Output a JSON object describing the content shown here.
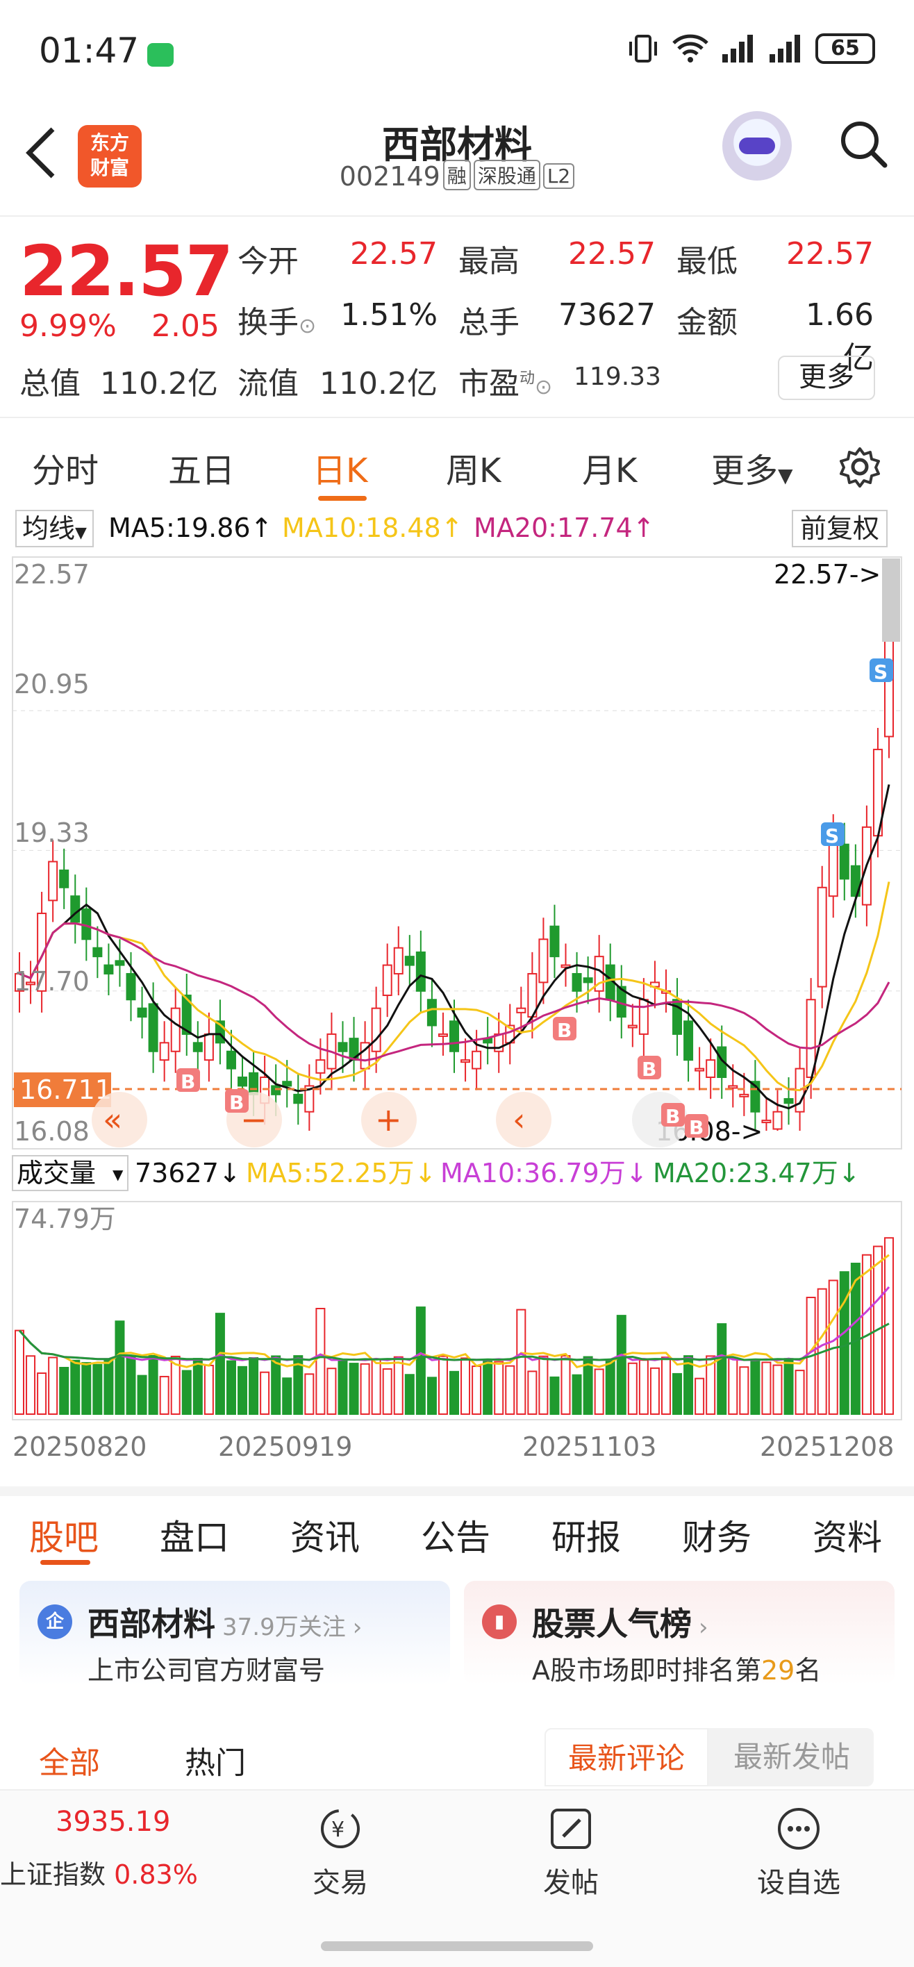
{
  "status": {
    "time": "01:47",
    "battery": "65"
  },
  "header": {
    "title": "西部材料",
    "code": "002149",
    "badges": [
      "融",
      "深股通",
      "L2"
    ],
    "logo_line1": "东方",
    "logo_line2": "财富"
  },
  "quote": {
    "price": "22.57",
    "pct": "9.99%",
    "change": "2.05",
    "open_label": "今开",
    "open": "22.57",
    "high_label": "最高",
    "high": "22.57",
    "low_label": "最低",
    "low": "22.57",
    "turnover_label": "换手",
    "turnover": "1.51%",
    "vol_label": "总手",
    "vol": "73627",
    "amount_label": "金额",
    "amount": "1.66亿",
    "mcap_label": "总值",
    "mcap": "110.2亿",
    "float_label": "流值",
    "float": "110.2亿",
    "pe_label": "市盈",
    "pe_sup": "动",
    "pe": "119.33",
    "more": "更多"
  },
  "period_tabs": [
    "分时",
    "五日",
    "日K",
    "周K",
    "月K",
    "更多"
  ],
  "indicator": {
    "box": "均线",
    "ma5": "MA5:19.86↑",
    "ma10": "MA10:18.48↑",
    "ma20": "MA20:17.74↑",
    "fq": "前复权",
    "colors": {
      "ma5": "#111111",
      "ma10": "#f5c518",
      "ma20": "#c4267e"
    }
  },
  "kline": {
    "y_labels": [
      "22.57",
      "20.95",
      "19.33",
      "17.70",
      "16.08"
    ],
    "current_price_tag": "16.711",
    "high_marker": "22.57->",
    "low_marker": "16.08->",
    "buy_marker": "B",
    "sell_marker": "S"
  },
  "volume": {
    "box": "成交量",
    "value": "73627↓",
    "ma5": "MA5:52.25万↓",
    "ma10": "MA10:36.79万↓",
    "ma20": "MA20:23.47万↓",
    "max_label": "74.79万",
    "dates": [
      "20250820",
      "20250919",
      "20251103",
      "20251208"
    ]
  },
  "chart_data": {
    "type": "candlestick",
    "title": "",
    "ylim": [
      16.08,
      22.57
    ],
    "x_dates": [
      "20250820",
      "20250919",
      "20251103",
      "20251208"
    ],
    "volume_ylim_label": "74.79万",
    "last_close": 22.57
  },
  "section_tabs": [
    "股吧",
    "盘口",
    "资讯",
    "公告",
    "研报",
    "财务",
    "资料"
  ],
  "cards": {
    "left_title": "西部材料",
    "left_follow": "37.9万关注",
    "left_sub": "上市公司官方财富号",
    "left_icon": "企",
    "right_title": "股票人气榜",
    "right_sub_a": "A股市场即时排名第",
    "right_rank": "29",
    "right_sub_b": "名"
  },
  "filters": {
    "all": "全部",
    "hot": "热门",
    "latest_comment": "最新评论",
    "latest_post": "最新发帖"
  },
  "bottom": {
    "index_value": "3935.19",
    "index_name": "上证指数",
    "index_pct": "0.83%",
    "trade": "交易",
    "post": "发帖",
    "watch": "设自选"
  }
}
